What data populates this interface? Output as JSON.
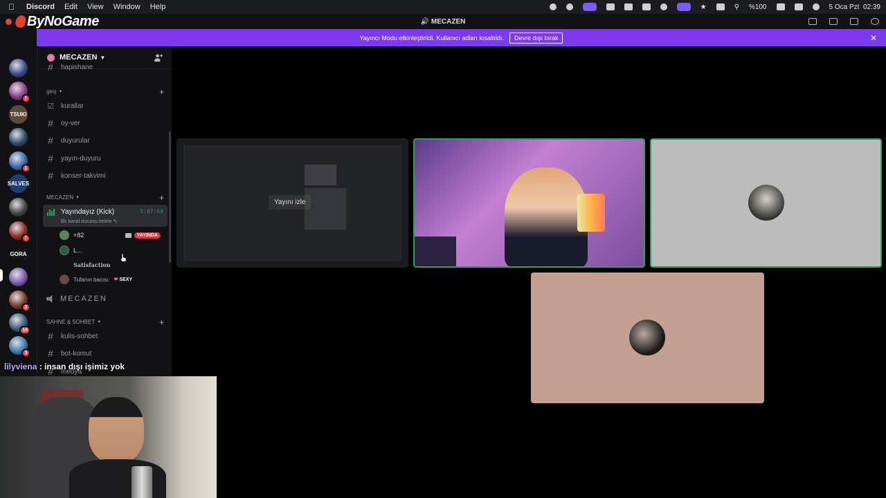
{
  "menubar": {
    "app": "Discord",
    "menus": [
      "Edit",
      "View",
      "Window",
      "Help"
    ],
    "battery": "%100",
    "date": "5 Oca Pzt",
    "time": "02:39"
  },
  "overlay_logo": "ByNoGame",
  "window": {
    "title": "MECAZEN"
  },
  "banner": {
    "text": "Yayıncı Modu etkinleştirildi. Kullanıcı adları kısaltıldı.",
    "button": "Devre dışı bırak"
  },
  "servers": [
    {
      "badge": ""
    },
    {
      "badge": "1"
    },
    {
      "label": "TSUKI",
      "badge": ""
    },
    {
      "badge": ""
    },
    {
      "badge": "1"
    },
    {
      "label": "SALVES",
      "badge": ""
    },
    {
      "badge": ""
    },
    {
      "badge": "1"
    },
    {
      "label": "GORA",
      "badge": ""
    },
    {
      "badge": ""
    },
    {
      "badge": "2"
    },
    {
      "badge": "10"
    },
    {
      "badge": "3"
    }
  ],
  "guild": {
    "name": "MECAZEN"
  },
  "sidebar": {
    "top_partial": "hapishane",
    "category_giris": "giriş",
    "channels_giris": [
      "kurallar",
      "oy-ver",
      "duyurular",
      "yayın-duyuru",
      "konser-takvimi"
    ],
    "category_mecazen": "MECAZEN",
    "voice_channel": {
      "name": "Yayındayız (Kick)",
      "time": "5:07:59",
      "status": "Bir kanal durumu belirle"
    },
    "members": [
      {
        "name": "+82",
        "live": "YAYINDA"
      },
      {
        "name": "L..."
      }
    ],
    "activity": "Satisfaction",
    "member3": {
      "name": "Tufanın bacısı.",
      "tag": "SEXY"
    },
    "stage": "MECAZEN",
    "category_sahne": "SAHNE & SOHBET",
    "channels_sahne": [
      "kulis-sohbet",
      "bot-komut",
      "medya"
    ]
  },
  "video": {
    "watch_label": "Yayını izle"
  },
  "overlay_chat": {
    "nick": "lilyviena",
    "message": " : insan dışı işimiz yok"
  },
  "colors": {
    "banner": "#7c3aed",
    "speaking": "#23a55a",
    "live": "#da373c"
  }
}
